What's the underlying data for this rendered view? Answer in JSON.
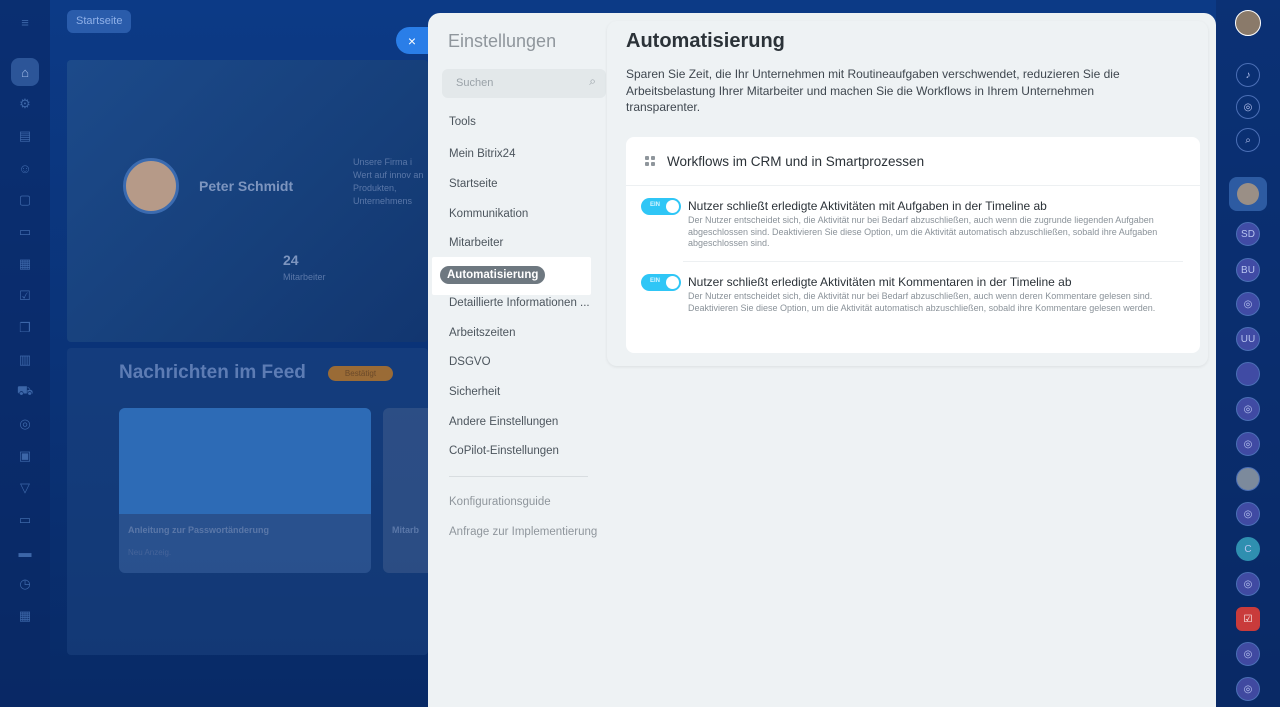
{
  "background": {
    "tab_label": "Startseite",
    "profile_name": "Peter Schmidt",
    "about_text": "Unsere Firma i Wert auf innov an Produkten, Unternehmens",
    "employees_count": "24",
    "employees_label": "Mitarbeiter",
    "feed_title": "Nachrichten im Feed",
    "feed_badge": "Bestätigt",
    "card1_title": "Anleitung zur Passwortänderung",
    "card1_meta": "Neu Anzeig.",
    "card2_title": "Mitarb"
  },
  "right_rail": {
    "avatars": [
      "SD",
      "BU",
      "UU",
      "C"
    ]
  },
  "panel": {
    "title": "Einstellungen",
    "close_label": "×",
    "search_placeholder": "Suchen",
    "nav": [
      {
        "label": "Tools"
      },
      {
        "label": "Mein Bitrix24"
      },
      {
        "label": "Startseite"
      },
      {
        "label": "Kommunikation"
      },
      {
        "label": "Mitarbeiter"
      },
      {
        "label": "Automatisierung"
      },
      {
        "label": "Detaillierte Informationen ..."
      },
      {
        "label": "Arbeitszeiten"
      },
      {
        "label": "DSGVO"
      },
      {
        "label": "Sicherheit"
      },
      {
        "label": "Andere Einstellungen"
      },
      {
        "label": "CoPilot-Einstellungen"
      }
    ],
    "nav_secondary": [
      {
        "label": "Konfigurationsguide"
      },
      {
        "label": "Anfrage zur Implementierung"
      }
    ],
    "content": {
      "heading": "Automatisierung",
      "description": "Sparen Sie Zeit, die Ihr Unternehmen mit Routineaufgaben verschwendet, reduzieren Sie die Arbeitsbelastung Ihrer Mitarbeiter und machen Sie die Workflows in Ihrem Unternehmen transparenter.",
      "section_title": "Workflows im CRM und in Smartprozessen",
      "options": [
        {
          "toggle_label": "EIN",
          "title": "Nutzer schließt erledigte Aktivitäten mit Aufgaben in der Timeline ab",
          "description": "Der Nutzer entscheidet sich, die Aktivität nur bei Bedarf abzuschließen, auch wenn die zugrunde liegenden Aufgaben abgeschlossen sind. Deaktivieren Sie diese Option, um die Aktivität automatisch abzuschließen, sobald ihre Aufgaben abgeschlossen sind."
        },
        {
          "toggle_label": "EIN",
          "title": "Nutzer schließt erledigte Aktivitäten mit Kommentaren in der Timeline ab",
          "description": "Der Nutzer entscheidet sich, die Aktivität nur bei Bedarf abzuschließen, auch wenn deren Kommentare gelesen sind. Deaktivieren Sie diese Option, um die Aktivität automatisch abzuschließen, sobald ihre Kommentare gelesen werden."
        }
      ]
    }
  },
  "colors": {
    "accent": "#2fc6f6",
    "close_button": "#2a7ee8",
    "active_nav": "#6e7880"
  }
}
